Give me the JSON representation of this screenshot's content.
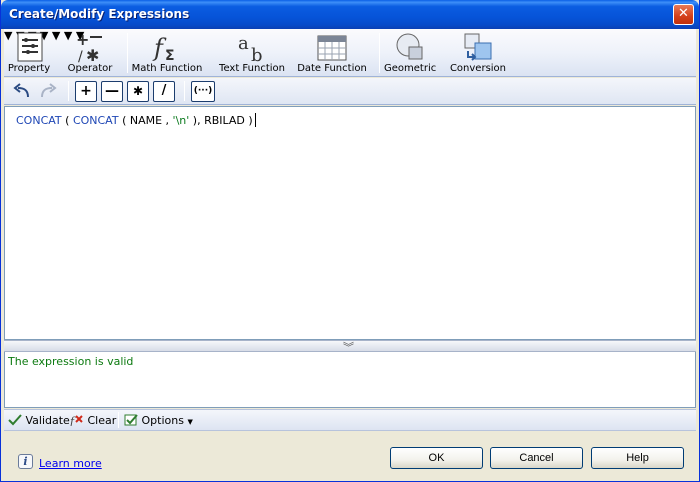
{
  "window": {
    "title": "Create/Modify Expressions",
    "close_glyph": "✕"
  },
  "toolbar": {
    "items": [
      {
        "label": "Property",
        "icon": "property-list-icon"
      },
      {
        "label": "Operator",
        "icon": "operator-icon"
      },
      {
        "label": "Math Function",
        "icon": "math-function-icon"
      },
      {
        "label": "Text Function",
        "icon": "text-function-icon"
      },
      {
        "label": "Date Function",
        "icon": "calendar-icon"
      },
      {
        "label": "Geometric",
        "icon": "geometric-icon"
      },
      {
        "label": "Conversion",
        "icon": "conversion-icon"
      }
    ]
  },
  "operators": {
    "plus": "+",
    "minus": "—",
    "multiply": "✱",
    "divide": "/",
    "parentheses": "(···)"
  },
  "editor": {
    "tokens": [
      {
        "text": "CONCAT",
        "kind": "fn"
      },
      {
        "text": " ( ",
        "kind": "plain"
      },
      {
        "text": "CONCAT",
        "kind": "fn"
      },
      {
        "text": " ( NAME , ",
        "kind": "plain"
      },
      {
        "text": "'\\n'",
        "kind": "str"
      },
      {
        "text": " ), RBILAD )",
        "kind": "plain"
      }
    ]
  },
  "status": {
    "message": "The expression is valid",
    "color": "#0c7a10"
  },
  "bottom_toolbar": {
    "validate": "Validate",
    "clear": "Clear",
    "options": "Options"
  },
  "footer": {
    "learn_more": "Learn more",
    "ok": "OK",
    "cancel": "Cancel",
    "help": "Help"
  }
}
